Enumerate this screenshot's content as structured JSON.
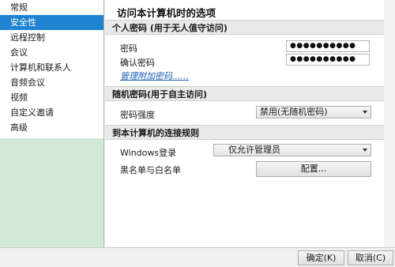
{
  "sidebar": {
    "items": [
      {
        "label": "常规"
      },
      {
        "label": "安全性",
        "selected": true
      },
      {
        "label": "远程控制"
      },
      {
        "label": "会议"
      },
      {
        "label": "计算机和联系人"
      },
      {
        "label": "音频会议"
      },
      {
        "label": "视频"
      },
      {
        "label": "自定义邀请"
      },
      {
        "label": "高级"
      }
    ]
  },
  "main": {
    "title": "访问本计算机时的选项",
    "personal_password": {
      "header": "个人密码 (用于无人值守访问)",
      "password_label": "密码",
      "password_value": "●●●●●●●●●●",
      "confirm_label": "确认密码",
      "confirm_value": "●●●●●●●●●●",
      "manage_link": "管理附加密码......"
    },
    "random_password": {
      "header": "随机密码(用于自主访问)",
      "strength_label": "密码强度",
      "strength_value": "禁用(无随机密码)"
    },
    "connection_rules": {
      "header": "到本计算机的连接规则",
      "windows_login_label": "Windows登录",
      "windows_login_value": "仅允许管理员",
      "blacklist_label": "黑名单与白名单",
      "configure_button": "配置..."
    }
  },
  "footer": {
    "ok_button": "确定(K)",
    "cancel_button": "取消(C)"
  },
  "colors": {
    "sidebar_bg": "#d3e8d6",
    "selection": "#1f83d2",
    "link": "#1c5fb3",
    "shield": "#f2b90d"
  }
}
